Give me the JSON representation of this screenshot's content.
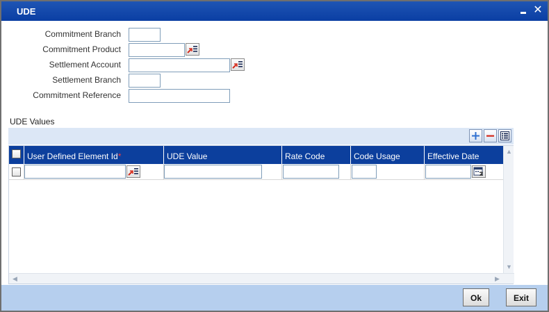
{
  "window": {
    "title": "UDE"
  },
  "form": {
    "commitment_branch": {
      "label": "Commitment Branch",
      "value": ""
    },
    "commitment_product": {
      "label": "Commitment Product",
      "value": ""
    },
    "settlement_account": {
      "label": "Settlement Account",
      "value": ""
    },
    "settlement_branch": {
      "label": "Settlement Branch",
      "value": ""
    },
    "commitment_reference": {
      "label": "Commitment Reference",
      "value": ""
    }
  },
  "ude_values": {
    "section_title": "UDE Values",
    "columns": [
      "User Defined Element Id",
      "UDE Value",
      "Rate Code",
      "Code Usage",
      "Effective Date"
    ],
    "required_marker": "*",
    "rows": [
      {
        "element_id": "",
        "ude_value": "",
        "rate_code": "",
        "code_usage": "",
        "effective_date": ""
      }
    ]
  },
  "footer": {
    "ok_label": "Ok",
    "exit_label": "Exit"
  },
  "icons": {
    "lov": "list-of-values-icon",
    "add": "plus-icon",
    "delete": "minus-icon",
    "single_view": "list-view-icon",
    "calendar": "calendar-icon"
  },
  "colors": {
    "titlebar": "#0a3ea3",
    "grid_header": "#0c3f9d",
    "footer": "#b6cfee",
    "toolbar_strip": "#dce7f6"
  }
}
